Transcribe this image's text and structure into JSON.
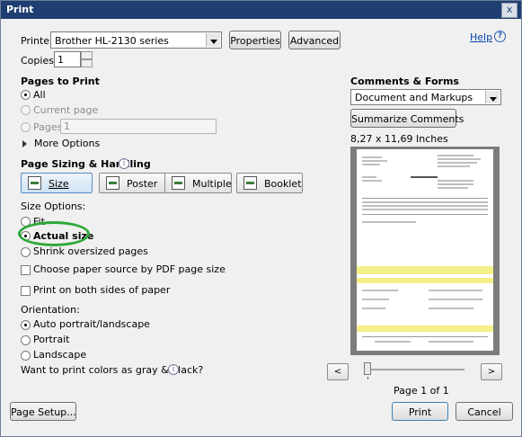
{
  "window": {
    "title": "Print",
    "close_label": "x"
  },
  "help": {
    "label": "Help"
  },
  "printer": {
    "label": "Printer:",
    "value": "Brother HL-2130 series",
    "properties_label": "Properties",
    "advanced_label": "Advanced"
  },
  "copies": {
    "label": "Copies:",
    "value": "1"
  },
  "pages_to_print": {
    "heading": "Pages to Print",
    "all": "All",
    "current": "Current page",
    "pages": "Pages",
    "pages_value": "1",
    "more_options": "More Options"
  },
  "sizing": {
    "heading": "Page Sizing & Handling",
    "tabs": [
      "Size",
      "Poster",
      "Multiple",
      "Booklet"
    ],
    "size_options_label": "Size Options:",
    "fit": "Fit",
    "actual_size": "Actual size",
    "shrink": "Shrink oversized pages",
    "choose_source": "Choose paper source by PDF page size",
    "both_sides": "Print on both sides of paper"
  },
  "orientation": {
    "label": "Orientation:",
    "auto": "Auto portrait/landscape",
    "portrait": "Portrait",
    "landscape": "Landscape"
  },
  "gray": {
    "label": "Want to print colors as gray & black?"
  },
  "comments": {
    "heading": "Comments & Forms",
    "value": "Document and Markups",
    "summarize_label": "Summarize Comments"
  },
  "preview": {
    "size": "8,27 x 11,69 Inches",
    "page_status": "Page 1 of 1",
    "prev": "<",
    "next": ">"
  },
  "buttons": {
    "page_setup": "Page Setup...",
    "print": "Print",
    "cancel": "Cancel"
  },
  "colors": {
    "titlebar": "#1f3f72",
    "highlight_ring": "#2ea83a",
    "preview_yellow": "#f6f08a"
  }
}
